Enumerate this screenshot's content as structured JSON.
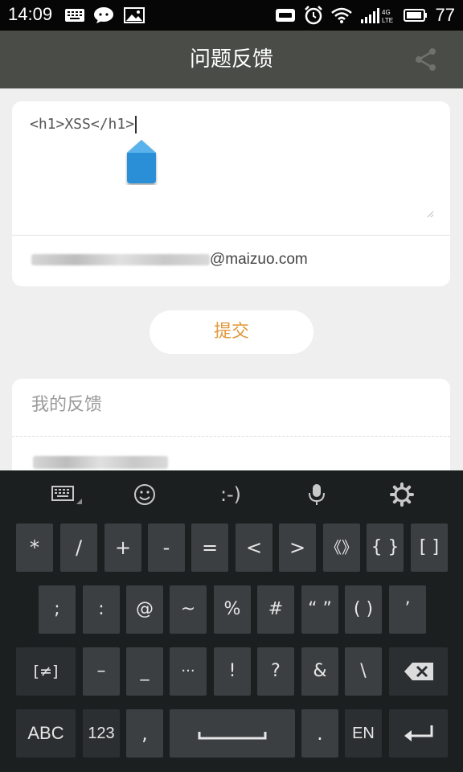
{
  "status_bar": {
    "time": "14:09",
    "battery": "77"
  },
  "app_bar": {
    "title": "问题反馈",
    "share_icon": "share-icon"
  },
  "feedback_form": {
    "text_value": "<h1>XSS</h1>",
    "email_suffix": "@maizuo.com"
  },
  "submit_label": "提交",
  "my_feedback": {
    "header": "我的反馈"
  },
  "keyboard": {
    "toolbar": {
      "emoticon_text": ":-)"
    },
    "row1": [
      "*",
      "/",
      "+",
      "-",
      "=",
      "<",
      ">",
      "《》",
      "{ }",
      "[ ]"
    ],
    "row2": [
      ";",
      ":",
      "@",
      "~",
      "%",
      "#",
      "“ ”",
      "( )",
      "’"
    ],
    "row3": [
      "[≠]",
      "–",
      "_",
      "···",
      "!",
      "?",
      "&",
      "\\"
    ],
    "row4": {
      "abc": "ABC",
      "num": "123",
      "comma": ",",
      "period": ".",
      "lang": "EN"
    }
  }
}
